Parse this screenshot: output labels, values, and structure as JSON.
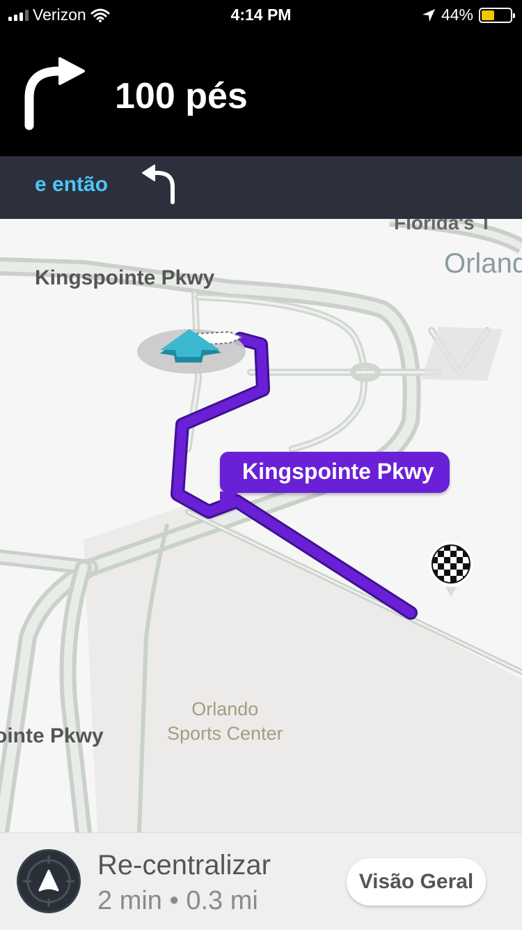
{
  "status_bar": {
    "carrier": "Verizon",
    "time": "4:14 PM",
    "battery_percent_text": "44%",
    "battery_level": 0.44,
    "battery_color": "#f3c700"
  },
  "navigation": {
    "next_turn_icon": "turn-right-arrow-icon",
    "distance": "100 pés",
    "then_label": "e então",
    "then_turn_icon": "turn-left-arrow-icon"
  },
  "map": {
    "street_bubble": "Kingspointe Pkwy",
    "labels": {
      "street_top": "Kingspointe Pkwy",
      "florida": "Florida's T",
      "city": "Orlando",
      "street_bottom": "ointe Pkwy",
      "poi_line1": "Orlando",
      "poi_line2": "Sports Center"
    },
    "route_color": "#6a20d6",
    "vehicle_color": "#3bb8cf"
  },
  "bottom_bar": {
    "recenter_label": "Re-centralizar",
    "eta": "2 min • 0.3 mi",
    "overview_button": "Visão Geral"
  }
}
